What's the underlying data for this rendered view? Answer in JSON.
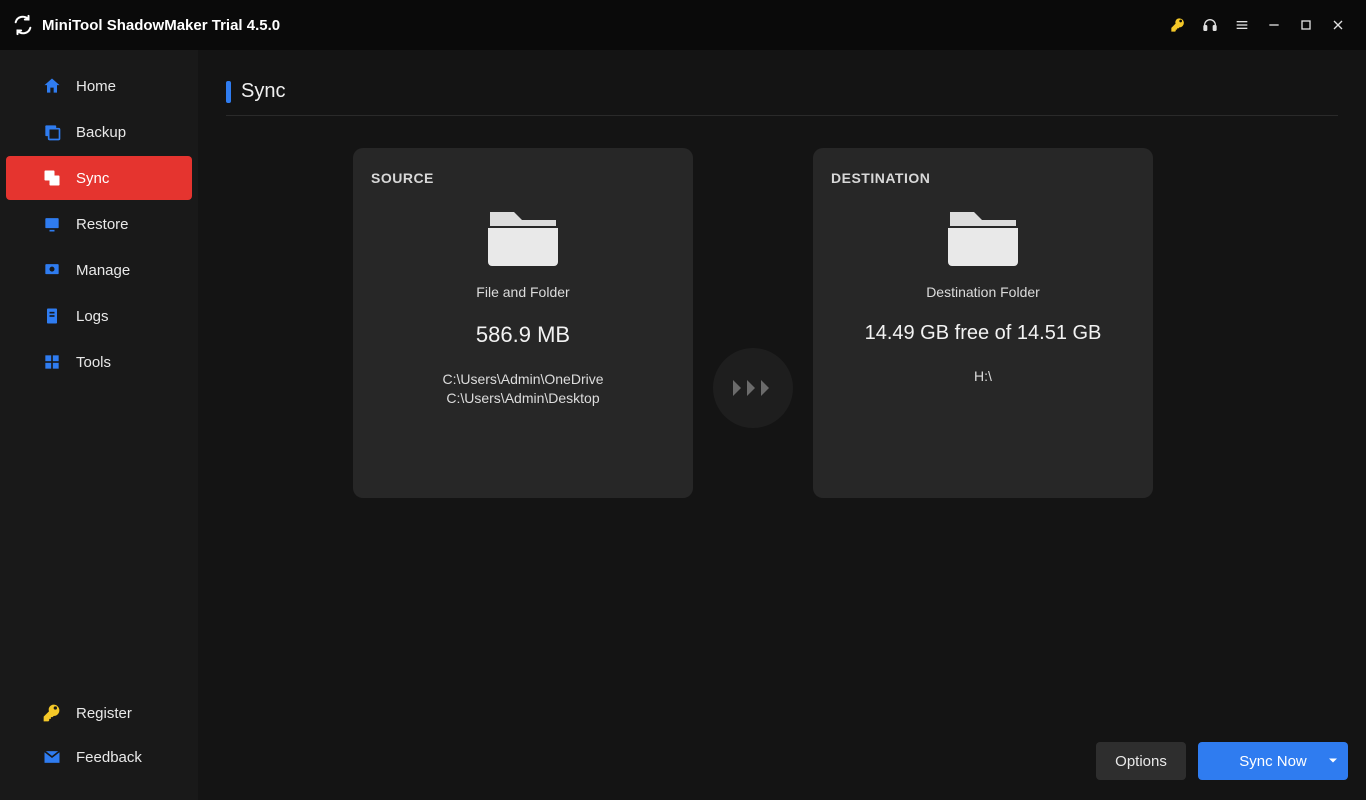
{
  "app": {
    "title": "MiniTool ShadowMaker Trial 4.5.0"
  },
  "sidebar": {
    "items": [
      {
        "label": "Home"
      },
      {
        "label": "Backup"
      },
      {
        "label": "Sync"
      },
      {
        "label": "Restore"
      },
      {
        "label": "Manage"
      },
      {
        "label": "Logs"
      },
      {
        "label": "Tools"
      }
    ],
    "bottom": {
      "register": "Register",
      "feedback": "Feedback"
    }
  },
  "page": {
    "title": "Sync"
  },
  "source": {
    "heading": "SOURCE",
    "title": "File and Folder",
    "size": "586.9 MB",
    "path1": "C:\\Users\\Admin\\OneDrive",
    "path2": "C:\\Users\\Admin\\Desktop"
  },
  "destination": {
    "heading": "DESTINATION",
    "title": "Destination Folder",
    "space": "14.49 GB free of 14.51 GB",
    "path": "H:\\"
  },
  "buttons": {
    "options": "Options",
    "sync_now": "Sync Now"
  }
}
